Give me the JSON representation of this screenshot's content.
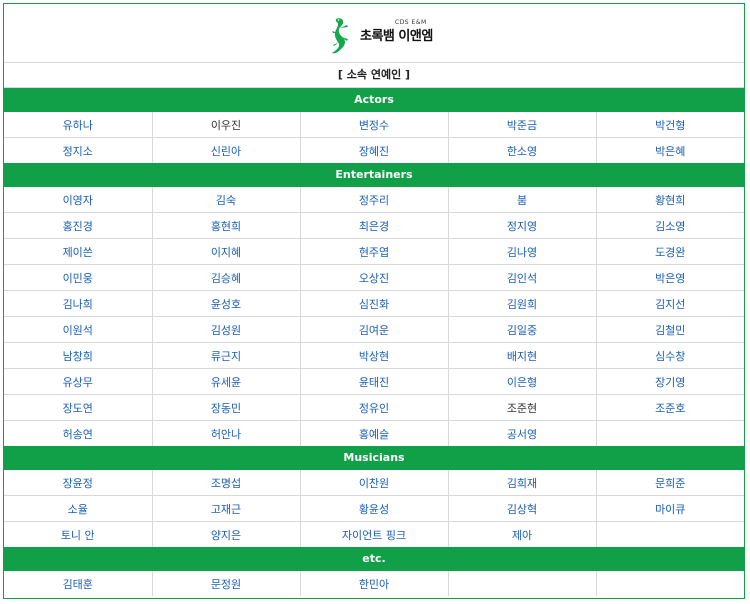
{
  "header": {
    "logo_top": "CDS E&M",
    "logo_text": "초록뱀 이앤엠",
    "title": "[ 소속 연예인 ]"
  },
  "colors": {
    "brand": "#11a048",
    "link": "#1a5fb4",
    "plain": "#333333"
  },
  "sections": [
    {
      "name": "Actors",
      "rows": [
        [
          {
            "t": "유하나"
          },
          {
            "t": "이우진",
            "plain": true
          },
          {
            "t": "변정수"
          },
          {
            "t": "박준금"
          },
          {
            "t": "박건형"
          }
        ],
        [
          {
            "t": "정지소"
          },
          {
            "t": "신린아"
          },
          {
            "t": "장혜진"
          },
          {
            "t": "한소영"
          },
          {
            "t": "박은혜"
          }
        ]
      ]
    },
    {
      "name": "Entertainers",
      "rows": [
        [
          {
            "t": "이영자"
          },
          {
            "t": "김숙"
          },
          {
            "t": "정주리"
          },
          {
            "t": "붐"
          },
          {
            "t": "황현희"
          }
        ],
        [
          {
            "t": "홍진경"
          },
          {
            "t": "홍현희"
          },
          {
            "t": "최은경"
          },
          {
            "t": "정지영"
          },
          {
            "t": "김소영"
          }
        ],
        [
          {
            "t": "제이쓴"
          },
          {
            "t": "이지혜"
          },
          {
            "t": "현주엽"
          },
          {
            "t": "김나영"
          },
          {
            "t": "도경완"
          }
        ],
        [
          {
            "t": "이민웅"
          },
          {
            "t": "김승혜"
          },
          {
            "t": "오상진"
          },
          {
            "t": "김인석"
          },
          {
            "t": "박은영"
          }
        ],
        [
          {
            "t": "김나희"
          },
          {
            "t": "윤성호"
          },
          {
            "t": "심진화"
          },
          {
            "t": "김원희"
          },
          {
            "t": "김지선"
          }
        ],
        [
          {
            "t": "이원석"
          },
          {
            "t": "김성원"
          },
          {
            "t": "김여운"
          },
          {
            "t": "김일중"
          },
          {
            "t": "김철민"
          }
        ],
        [
          {
            "t": "남창희"
          },
          {
            "t": "류근지"
          },
          {
            "t": "박상현"
          },
          {
            "t": "배지현"
          },
          {
            "t": "심수창"
          }
        ],
        [
          {
            "t": "유상무"
          },
          {
            "t": "유세윤"
          },
          {
            "t": "윤태진"
          },
          {
            "t": "이은형"
          },
          {
            "t": "장기영"
          }
        ],
        [
          {
            "t": "장도연"
          },
          {
            "t": "장동민"
          },
          {
            "t": "정유인"
          },
          {
            "t": "조준현",
            "plain": true
          },
          {
            "t": "조준호"
          }
        ],
        [
          {
            "t": "허송연"
          },
          {
            "t": "허안나"
          },
          {
            "t": "홍예슬"
          },
          {
            "t": "공서영"
          },
          {
            "t": ""
          }
        ]
      ]
    },
    {
      "name": "Musicians",
      "rows": [
        [
          {
            "t": "장윤정"
          },
          {
            "t": "조명섭"
          },
          {
            "t": "이찬원"
          },
          {
            "t": "김희재"
          },
          {
            "t": "문희준"
          }
        ],
        [
          {
            "t": "소율"
          },
          {
            "t": "고재근"
          },
          {
            "t": "황윤성"
          },
          {
            "t": "김상혁"
          },
          {
            "t": "마이큐"
          }
        ],
        [
          {
            "t": "토니 안"
          },
          {
            "t": "양지은"
          },
          {
            "t": "자이언트 핑크"
          },
          {
            "t": "제아"
          },
          {
            "t": ""
          }
        ]
      ]
    },
    {
      "name": "etc.",
      "rows": [
        [
          {
            "t": "김태훈"
          },
          {
            "t": "문정원"
          },
          {
            "t": "한민아"
          },
          {
            "t": ""
          },
          {
            "t": ""
          }
        ]
      ]
    }
  ]
}
